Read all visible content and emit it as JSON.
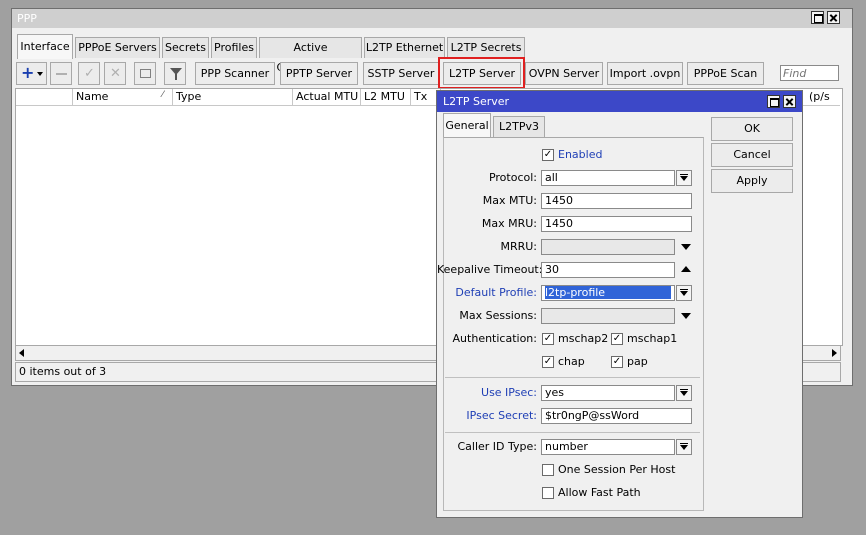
{
  "ppp": {
    "title": "PPP",
    "tabs": [
      "Interface",
      "PPPoE Servers",
      "Secrets",
      "Profiles",
      "Active Connections",
      "L2TP Ethernet",
      "L2TP Secrets"
    ],
    "toolbar": {
      "ppp_scanner": "PPP Scanner",
      "pptp_server": "PPTP Server",
      "sstp_server": "SSTP Server",
      "l2tp_server": "L2TP Server",
      "ovpn_server": "OVPN Server",
      "import_ovpn": "Import .ovpn",
      "pppoe_scan": "PPPoE Scan",
      "find_placeholder": "Find"
    },
    "columns": [
      "Name",
      "Type",
      "Actual MTU",
      "L2 MTU",
      "Tx",
      "(p/s"
    ],
    "status": "0 items out of 3"
  },
  "dialog": {
    "title": "L2TP Server",
    "tabs": [
      "General",
      "L2TPv3"
    ],
    "buttons": {
      "ok": "OK",
      "cancel": "Cancel",
      "apply": "Apply"
    },
    "enabled_label": "Enabled",
    "protocol": {
      "label": "Protocol:",
      "value": "all"
    },
    "max_mtu": {
      "label": "Max MTU:",
      "value": "1450"
    },
    "max_mru": {
      "label": "Max MRU:",
      "value": "1450"
    },
    "mrru": {
      "label": "MRRU:",
      "value": ""
    },
    "keepalive": {
      "label": "Keepalive Timeout:",
      "value": "30"
    },
    "default_profile": {
      "label": "Default Profile:",
      "value": "l2tp-profile"
    },
    "max_sessions": {
      "label": "Max Sessions:",
      "value": ""
    },
    "auth": {
      "label": "Authentication:",
      "mschap2": "mschap2",
      "mschap1": "mschap1",
      "chap": "chap",
      "pap": "pap"
    },
    "use_ipsec": {
      "label": "Use IPsec:",
      "value": "yes"
    },
    "ipsec_secret": {
      "label": "IPsec Secret:",
      "value": "$tr0ngP@ssWord"
    },
    "caller_id": {
      "label": "Caller ID Type:",
      "value": "number"
    },
    "one_session": "One Session Per Host",
    "allow_fast_path": "Allow Fast Path"
  },
  "colors": {
    "dialog_title": "#3c48c8",
    "highlight_border": "#e02020",
    "selection": "#3064d8",
    "link_label": "#1f3fb5"
  }
}
